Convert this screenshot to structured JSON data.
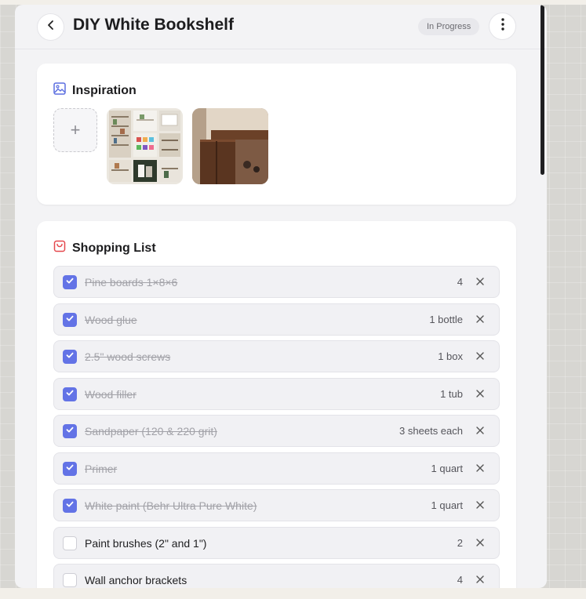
{
  "header": {
    "title": "DIY White Bookshelf",
    "status": "In Progress"
  },
  "inspiration": {
    "title": "Inspiration",
    "add_label": "+"
  },
  "shopping": {
    "title": "Shopping List",
    "items": [
      {
        "name": "Pine boards 1×8×6",
        "qty": "4",
        "checked": true
      },
      {
        "name": "Wood glue",
        "qty": "1 bottle",
        "checked": true
      },
      {
        "name": "2.5\" wood screws",
        "qty": "1 box",
        "checked": true
      },
      {
        "name": "Wood filler",
        "qty": "1 tub",
        "checked": true
      },
      {
        "name": "Sandpaper (120 & 220 grit)",
        "qty": "3 sheets each",
        "checked": true
      },
      {
        "name": "Primer",
        "qty": "1 quart",
        "checked": true
      },
      {
        "name": "White paint (Behr Ultra Pure White)",
        "qty": "1 quart",
        "checked": true
      },
      {
        "name": "Paint brushes (2\" and 1\")",
        "qty": "2",
        "checked": false
      },
      {
        "name": "Wall anchor brackets",
        "qty": "4",
        "checked": false
      }
    ]
  },
  "colors": {
    "accent": "#6373e6",
    "inspiration_icon": "#5b6ee0",
    "shopping_icon": "#e5484d"
  }
}
